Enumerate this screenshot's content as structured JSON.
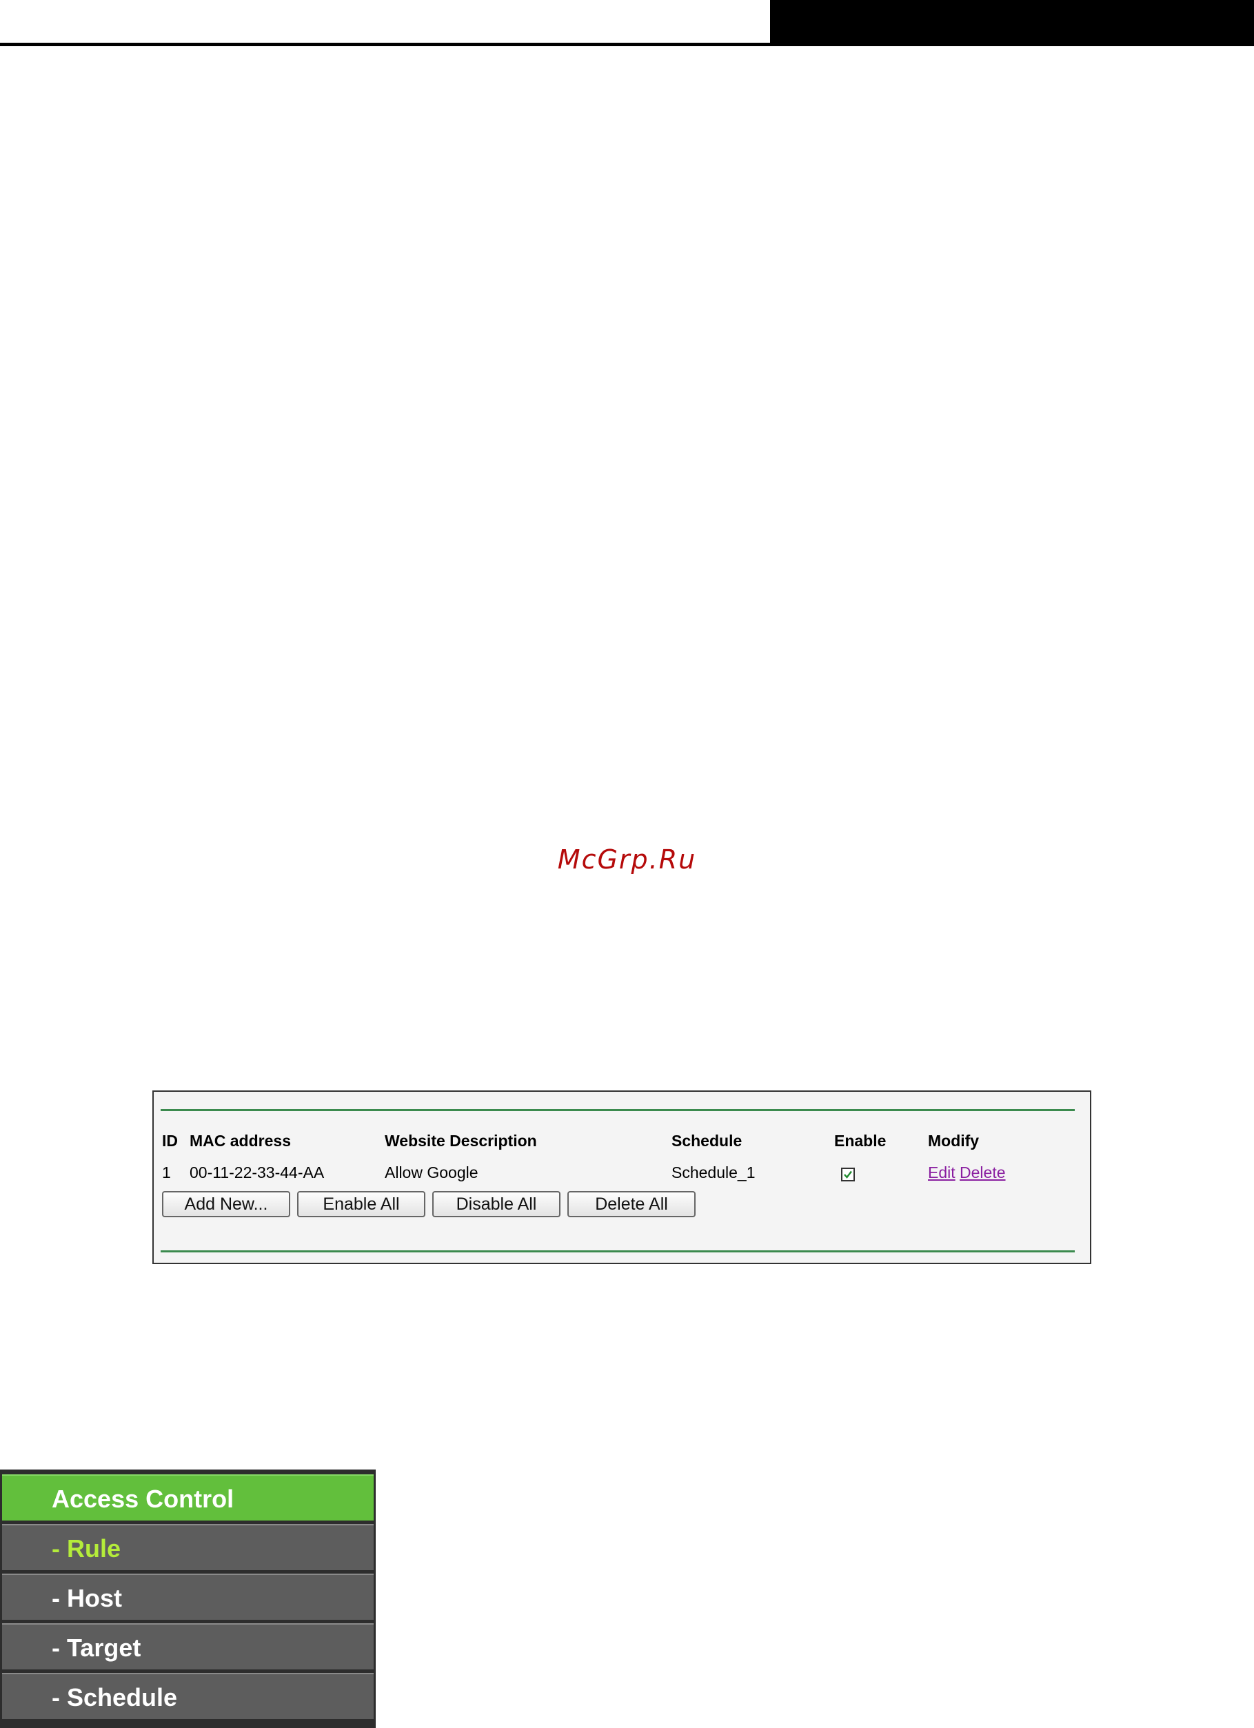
{
  "watermark": {
    "text": "McGrp.Ru"
  },
  "rules_table": {
    "headers": {
      "id": "ID",
      "mac": "MAC address",
      "description": "Website Description",
      "schedule": "Schedule",
      "enable": "Enable",
      "modify": "Modify"
    },
    "rows": [
      {
        "id": "1",
        "mac": "00-11-22-33-44-AA",
        "description": "Allow Google",
        "schedule": "Schedule_1",
        "enabled": true,
        "edit_label": "Edit",
        "delete_label": "Delete"
      }
    ],
    "buttons": {
      "add_new": "Add New...",
      "enable_all": "Enable All",
      "disable_all": "Disable All",
      "delete_all": "Delete All"
    }
  },
  "menu": {
    "header": "Access Control",
    "items": [
      "- Rule",
      "- Host",
      "- Target",
      "- Schedule"
    ],
    "active_index": 0
  },
  "colors": {
    "menu_header": "#62bf3c",
    "menu_item": "#5d5d5d",
    "menu_active_text": "#b4ec3a",
    "panel_line": "#3b8a4e",
    "link": "#8a1ea0",
    "watermark": "#b50a0a"
  }
}
